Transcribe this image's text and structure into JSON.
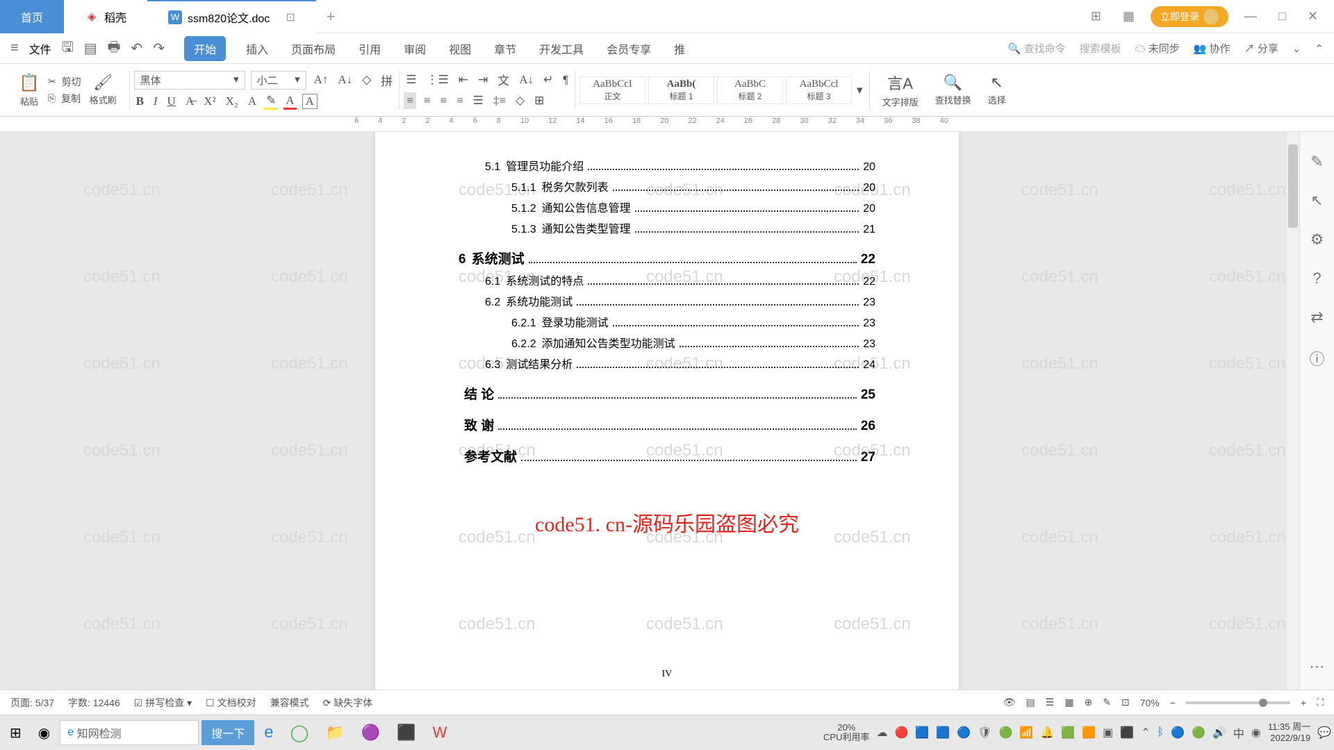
{
  "tabs": {
    "home": "首页",
    "daoke": "稻壳",
    "doc": "ssm820论文.doc"
  },
  "login_btn": "立即登录",
  "file_menu": "文件",
  "menu": {
    "start": "开始",
    "insert": "插入",
    "layout": "页面布局",
    "ref": "引用",
    "review": "审阅",
    "view": "视图",
    "chapter": "章节",
    "dev": "开发工具",
    "vip": "会员专享",
    "rec": "推"
  },
  "menu_right": {
    "search_cmd": "查找命令",
    "search_tpl": "搜索模板",
    "sync": "未同步",
    "collab": "协作",
    "share": "分享"
  },
  "clipboard": {
    "paste": "粘贴",
    "cut": "剪切",
    "copy": "复制",
    "format": "格式刷"
  },
  "font": {
    "name": "黑体",
    "size": "小二"
  },
  "styles": {
    "s1_preview": "AaBbCcI",
    "s1_name": "正文",
    "s2_preview": "AaBb(",
    "s2_name": "标题 1",
    "s3_preview": "AaBbC",
    "s3_name": "标题 2",
    "s4_preview": "AaBbCcl",
    "s4_name": "标题 3"
  },
  "tool_right": {
    "text_layout": "文字排版",
    "find_replace": "查找替换",
    "select": "选择"
  },
  "ruler_marks": [
    "6",
    "4",
    "2",
    "2",
    "4",
    "6",
    "8",
    "10",
    "12",
    "14",
    "16",
    "18",
    "20",
    "22",
    "24",
    "26",
    "28",
    "30",
    "32",
    "34",
    "36",
    "38",
    "40"
  ],
  "toc": [
    {
      "lvl": 2,
      "num": "5.1",
      "title": "管理员功能介绍",
      "page": "20"
    },
    {
      "lvl": 3,
      "num": "5.1.1",
      "title": "税务欠款列表",
      "page": "20"
    },
    {
      "lvl": 3,
      "num": "5.1.2",
      "title": "通知公告信息管理",
      "page": "20"
    },
    {
      "lvl": 3,
      "num": "5.1.3",
      "title": "通知公告类型管理",
      "page": "21"
    },
    {
      "lvl": 1,
      "num": "6",
      "title": "系统测试",
      "page": "22"
    },
    {
      "lvl": 2,
      "num": "6.1",
      "title": "系统测试的特点",
      "page": "22"
    },
    {
      "lvl": 2,
      "num": "6.2",
      "title": "系统功能测试",
      "page": "23"
    },
    {
      "lvl": 3,
      "num": "6.2.1",
      "title": "登录功能测试",
      "page": "23"
    },
    {
      "lvl": 3,
      "num": "6.2.2",
      "title": "添加通知公告类型功能测试",
      "page": "23"
    },
    {
      "lvl": 2,
      "num": "6.3",
      "title": "测试结果分析",
      "page": "24"
    },
    {
      "lvl": 1,
      "num": "",
      "title": "结  论",
      "page": "25"
    },
    {
      "lvl": 1,
      "num": "",
      "title": "致  谢",
      "page": "26"
    },
    {
      "lvl": 1,
      "num": "",
      "title": "参考文献",
      "page": "27"
    }
  ],
  "page_footer": "IV",
  "red_overlay": "code51. cn-源码乐园盗图必究",
  "watermark_text": "code51.cn",
  "status": {
    "page": "页面: 5/37",
    "words": "字数: 12446",
    "spell": "拼写检查",
    "proof": "文档校对",
    "compat": "兼容模式",
    "missing_font": "缺失字体",
    "zoom": "70%"
  },
  "taskbar": {
    "search_ph": "知网检测",
    "search_btn": "搜一下",
    "cpu_pct": "20%",
    "cpu_label": "CPU利用率",
    "time": "11:35 周一",
    "date": "2022/9/19"
  }
}
